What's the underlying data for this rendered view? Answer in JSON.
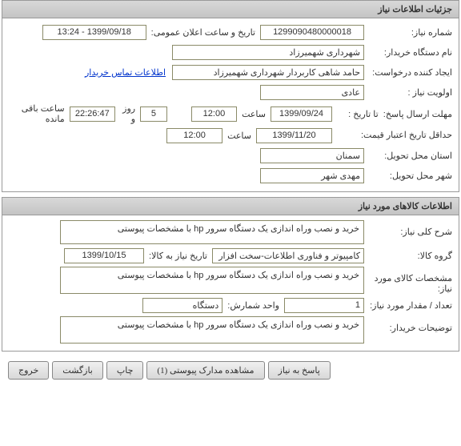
{
  "panel1": {
    "title": "جزئیات اطلاعات نیاز",
    "rows": {
      "need_number_label": "شماره نیاز:",
      "need_number": "1299090480000018",
      "announce_label": "تاریخ و ساعت اعلان عمومی:",
      "announce_value": "1399/09/18 - 13:24",
      "buyer_label": "نام دستگاه خریدار:",
      "buyer_value": "شهرداری شهمیرزاد",
      "creator_label": "ایجاد کننده درخواست:",
      "creator_value": "حامد شاهی کاربردار شهرداری شهمیرزاد",
      "contact_link": "اطلاعات تماس خریدار",
      "priority_label": "اولویت نیاز :",
      "priority_value": "عادی",
      "deadline_label": "مهلت ارسال پاسخ:",
      "to_date_label": "تا تاریخ :",
      "deadline_date": "1399/09/24",
      "time_label": "ساعت",
      "deadline_time": "12:00",
      "days_count": "5",
      "days_label": "روز و",
      "remaining_time": "22:26:47",
      "remaining_label": "ساعت باقی مانده",
      "validity_label": "حداقل تاریخ اعتبار قیمت:",
      "validity_date": "1399/11/20",
      "validity_time": "12:00",
      "province_label": "استان محل تحویل:",
      "province_value": "سمنان",
      "city_label": "شهر محل تحویل:",
      "city_value": "مهدی شهر"
    }
  },
  "panel2": {
    "title": "اطلاعات کالاهای مورد نیاز",
    "rows": {
      "desc_label": "شرح کلی نیاز:",
      "desc_value": "خرید و نصب وراه اندازی یک دستگاه سرور hp با مشخصات پیوستی",
      "group_label": "گروه کالا:",
      "group_value": "کامپیوتر و فناوری اطلاعات-سخت افزار",
      "need_date_label": "تاریخ نیاز به کالا:",
      "need_date_value": "1399/10/15",
      "spec_label": "مشخصات کالای مورد نیاز:",
      "spec_value": "خرید و نصب وراه اندازی یک دستگاه سرور hp با مشخصات پیوستی",
      "qty_label": "تعداد / مقدار مورد نیاز:",
      "qty_value": "1",
      "unit_label": "واحد شمارش:",
      "unit_value": "دستگاه",
      "buyer_notes_label": "توضیحات خریدار:",
      "buyer_notes_value": "خرید و نصب وراه اندازی یک دستگاه سرور hp با مشخصات پیوستی"
    }
  },
  "footer": {
    "respond": "پاسخ به نیاز",
    "attachments": "مشاهده مدارک پیوستی  (1)",
    "print": "چاپ",
    "back": "بازگشت",
    "exit": "خروج"
  }
}
